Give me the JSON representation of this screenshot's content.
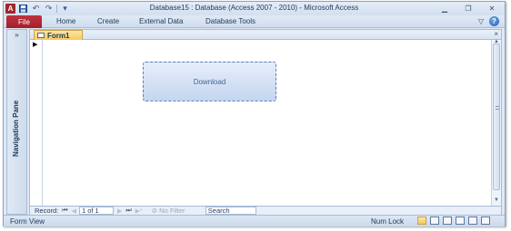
{
  "window": {
    "title": "Database15 : Database (Access 2007 - 2010)  -  Microsoft Access",
    "app_icon_letter": "A",
    "qat_icons": [
      "save-icon",
      "undo-icon",
      "redo-icon",
      "customize-qat-icon"
    ],
    "controls": [
      "minimize-icon",
      "restore-icon",
      "close-icon"
    ]
  },
  "ribbon": {
    "file_label": "File",
    "tabs": [
      "Home",
      "Create",
      "External Data",
      "Database Tools"
    ],
    "help_glyph": "?"
  },
  "nav_pane": {
    "toggle": "»",
    "label": "Navigation Pane"
  },
  "document": {
    "tab_label": "Form1",
    "close_glyph": "×",
    "record_selector_glyph": "▶",
    "button_label": "Download"
  },
  "record_nav": {
    "label": "Record:",
    "first": "⏮",
    "prev": "◀",
    "current": "1 of 1",
    "next": "▶",
    "last": "⏭",
    "new": "▶*",
    "filter_label": "No Filter",
    "search_label": "Search"
  },
  "statusbar": {
    "left": "Form View",
    "right": "Num Lock",
    "view_icons": [
      "form-view-icon",
      "datasheet-view-icon",
      "pivottable-view-icon",
      "pivotchart-view-icon",
      "layout-view-icon",
      "design-view-icon"
    ]
  }
}
